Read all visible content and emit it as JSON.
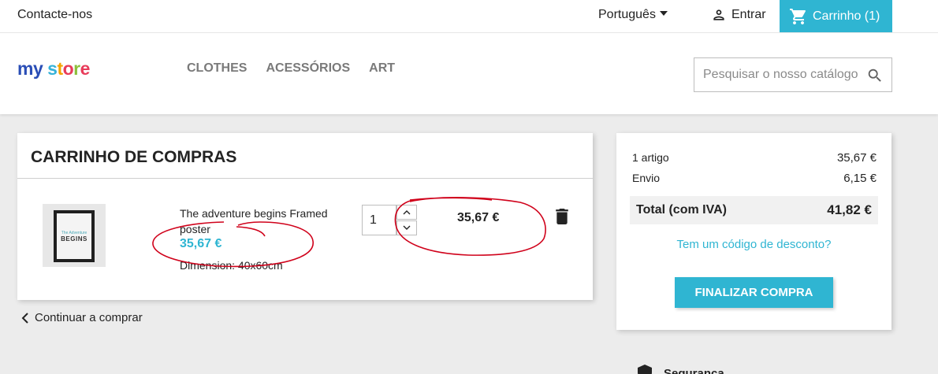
{
  "topbar": {
    "contact_label": "Contacte-nos",
    "language_label": "Português",
    "signin_label": "Entrar",
    "cart_label": "Carrinho (1)"
  },
  "header": {
    "logo_parts": [
      "my",
      " ",
      "s",
      "t",
      "o",
      "r",
      "e"
    ],
    "menu": [
      "CLOTHES",
      "ACESSÓRIOS",
      "ART"
    ],
    "search_placeholder": "Pesquisar o nosso catálogo"
  },
  "cart": {
    "title": "CARRINHO DE COMPRAS",
    "item": {
      "thumb_text_small": "The Adventure",
      "thumb_text_big": "BEGINS",
      "name": "The adventure begins Framed poster",
      "price": "35,67 €",
      "attribute": "Dimension: 40x60cm",
      "quantity": "1",
      "line_total": "35,67 €"
    },
    "continue_label": "Continuar a comprar"
  },
  "summary": {
    "items_label": "1 artigo",
    "items_value": "35,67 €",
    "shipping_label": "Envio",
    "shipping_value": "6,15 €",
    "total_label": "Total (com IVA)",
    "total_value": "41,82 €",
    "promo_label": "Tem um código de desconto?",
    "checkout_label": "FINALIZAR COMPRA"
  },
  "reassurance": {
    "label": "Segurança"
  },
  "colors": {
    "accent": "#2fb5d2",
    "annotation": "#d0021b"
  },
  "icons": [
    "caret-down-icon",
    "person-icon",
    "cart-icon",
    "search-icon",
    "chevron-up-icon",
    "chevron-down-icon",
    "trash-icon",
    "chevron-left-icon",
    "shield-icon"
  ]
}
